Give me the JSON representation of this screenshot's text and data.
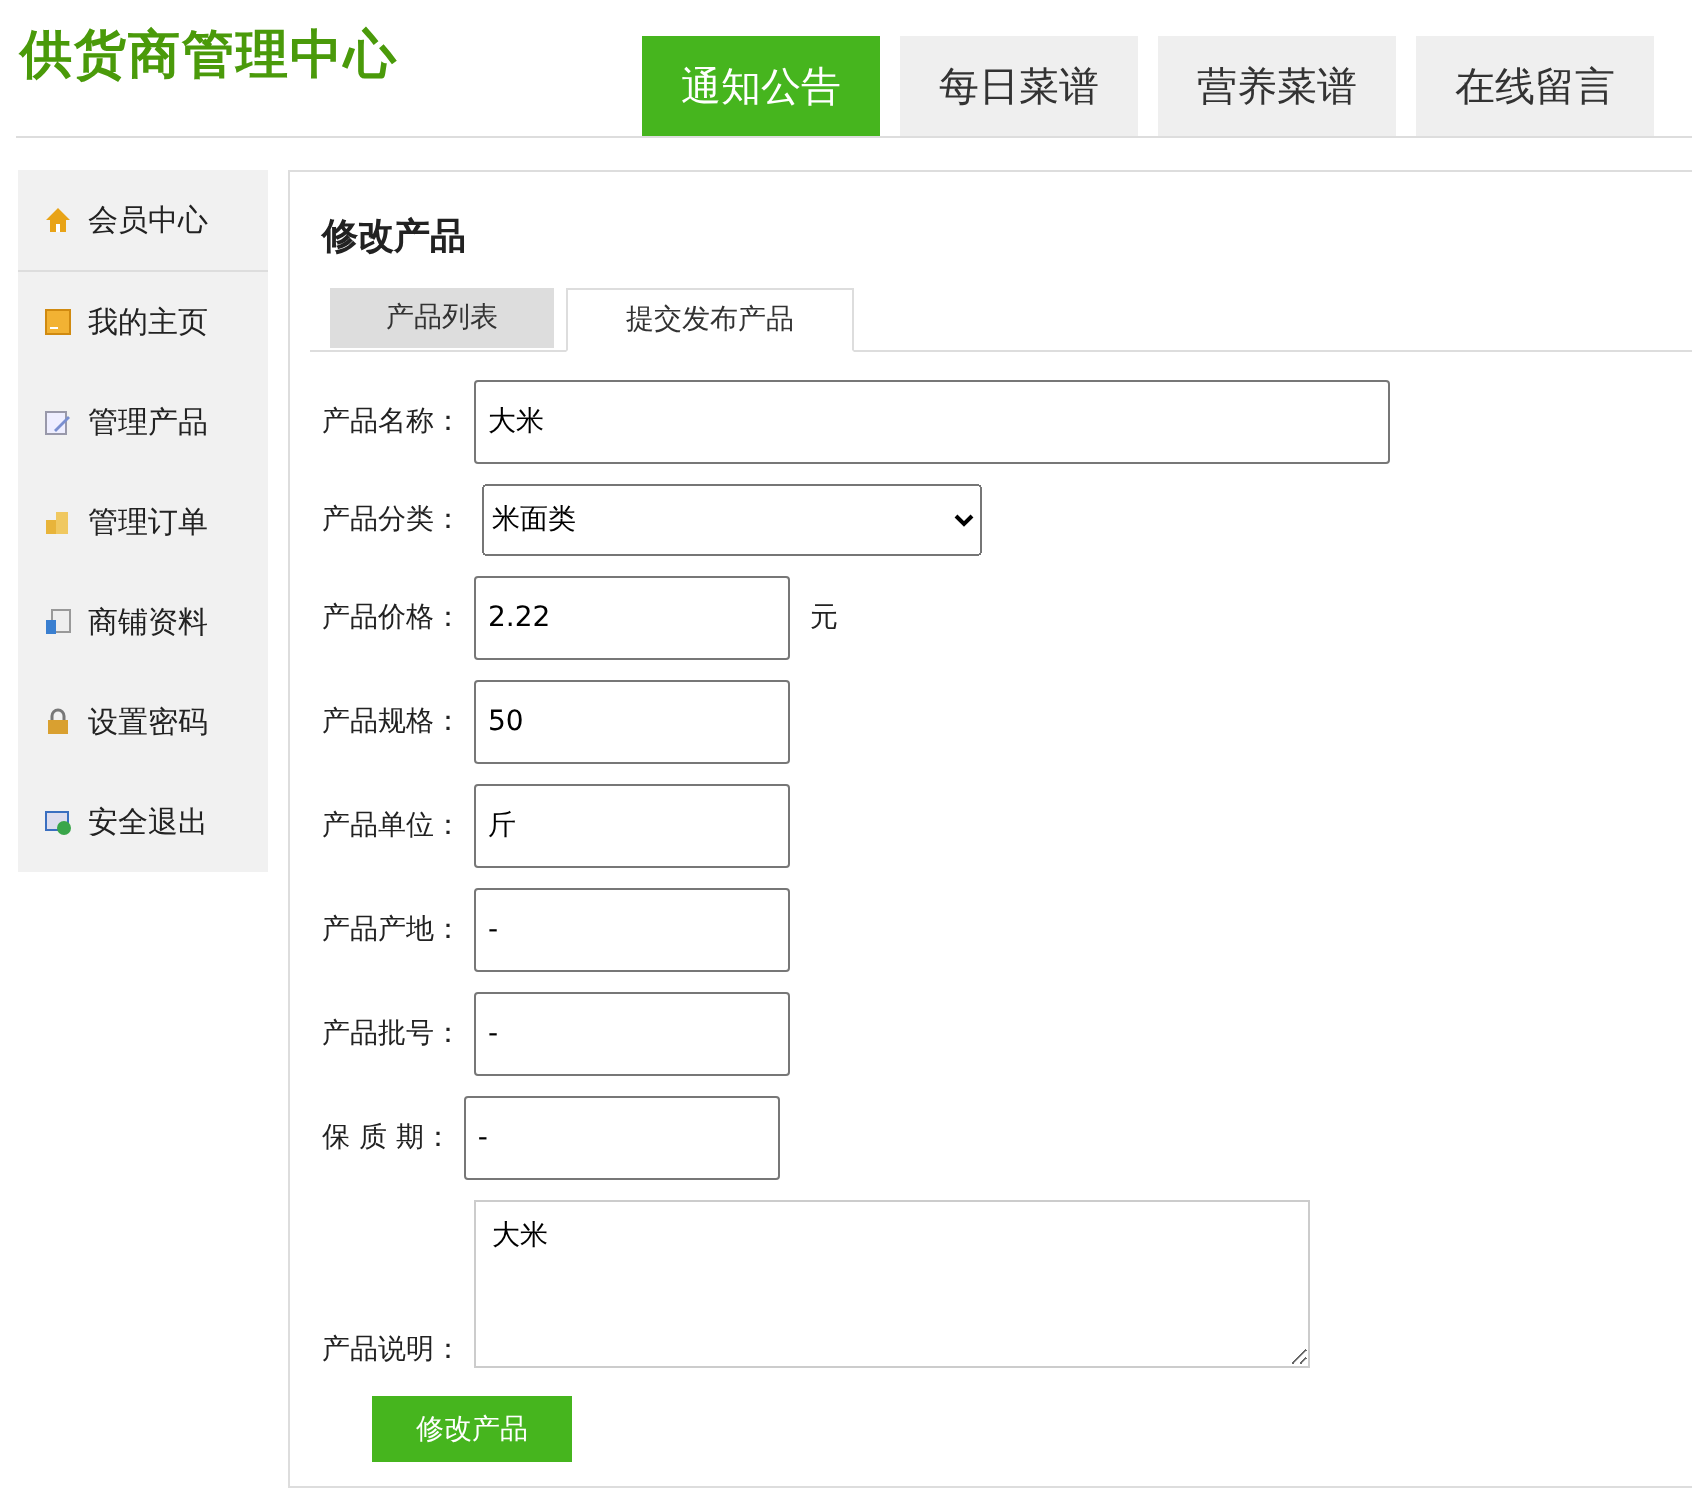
{
  "site_title": "供货商管理中心",
  "nav_tabs": [
    {
      "label": "通知公告",
      "selected": true
    },
    {
      "label": "每日菜谱",
      "selected": false
    },
    {
      "label": "营养菜谱",
      "selected": false
    },
    {
      "label": "在线留言",
      "selected": false
    }
  ],
  "sidebar": {
    "items": [
      {
        "label": "会员中心"
      },
      {
        "label": "我的主页"
      },
      {
        "label": "管理产品"
      },
      {
        "label": "管理订单"
      },
      {
        "label": "商铺资料"
      },
      {
        "label": "设置密码"
      },
      {
        "label": "安全退出"
      }
    ]
  },
  "panel": {
    "title": "修改产品",
    "tabs": [
      {
        "label": "产品列表",
        "selected": false
      },
      {
        "label": "提交发布产品",
        "selected": true
      }
    ],
    "fields": [
      {
        "kind": "wide_input",
        "label": "产品名称：",
        "value": "大米"
      },
      {
        "kind": "select",
        "label": "产品分类：",
        "value": "米面类"
      },
      {
        "kind": "input",
        "label": "产品价格：",
        "value": "2.22",
        "suffix": "元"
      },
      {
        "kind": "input",
        "label": "产品规格：",
        "value": "50"
      },
      {
        "kind": "input",
        "label": "产品单位：",
        "value": "斤"
      },
      {
        "kind": "input",
        "label": "产品产地：",
        "value": "-"
      },
      {
        "kind": "input",
        "label": "产品批号：",
        "value": "-"
      },
      {
        "kind": "input",
        "label": "保 质 期：",
        "value": "-"
      },
      {
        "kind": "textarea",
        "label": "产品说明：",
        "value": "大米"
      }
    ],
    "submit": "修改产品"
  }
}
